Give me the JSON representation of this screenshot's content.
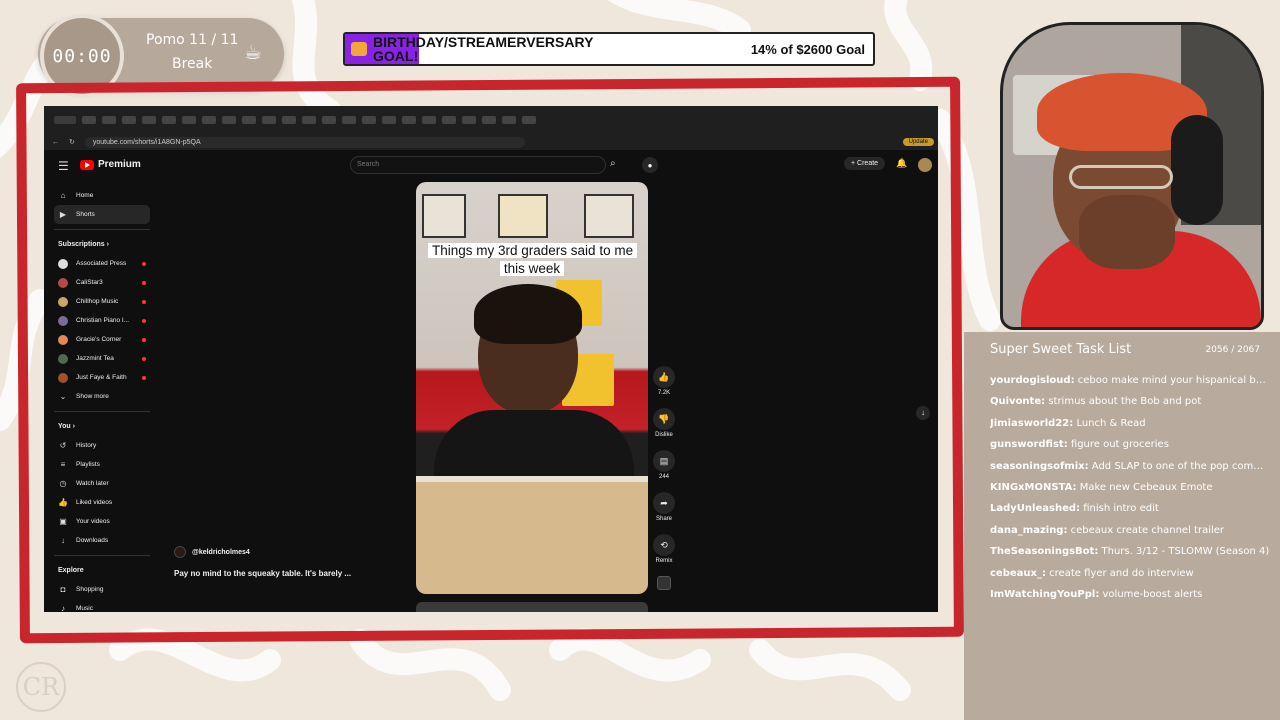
{
  "pomodoro": {
    "time": "00:00",
    "label": "Pomo 11 / 11",
    "state": "Break",
    "icon": "coffee-cup-icon"
  },
  "goal": {
    "title": "BIRTHDAY/STREAMERVERSARY GOAL!",
    "progress_text": "14% of $2600 Goal",
    "progress_fraction": 0.14,
    "accent": "#8a22e6"
  },
  "browser": {
    "url": "youtube.com/shorts/i1A8GN-p5QA",
    "update_label": "Update"
  },
  "youtube": {
    "brand": "Premium",
    "search_placeholder": "Search",
    "create_label": "Create",
    "sidebar": {
      "top_items": [
        {
          "label": "Home",
          "icon": "home-icon"
        },
        {
          "label": "Shorts",
          "icon": "shorts-icon"
        }
      ],
      "subscriptions_heading": "Subscriptions",
      "subscriptions": [
        "Associated Press",
        "CaliStar3",
        "Chillhop Music",
        "Christian Piano I...",
        "Gracie's Corner",
        "Jazzmint Tea",
        "Just Faye & Faith"
      ],
      "show_more": "Show more",
      "you_heading": "You",
      "you_items": [
        {
          "label": "History",
          "icon": "history-icon"
        },
        {
          "label": "Playlists",
          "icon": "playlists-icon"
        },
        {
          "label": "Watch later",
          "icon": "clock-icon"
        },
        {
          "label": "Liked videos",
          "icon": "thumbs-up-icon"
        },
        {
          "label": "Your videos",
          "icon": "video-icon"
        },
        {
          "label": "Downloads",
          "icon": "download-icon"
        }
      ],
      "explore_heading": "Explore",
      "explore_items": [
        {
          "label": "Shopping",
          "icon": "bag-icon"
        },
        {
          "label": "Music",
          "icon": "music-icon"
        }
      ]
    },
    "short": {
      "caption": "Things my 3rd graders said to me this week",
      "handle": "@keldricholmes4",
      "description": "Pay no mind to the squeaky table. It's barely ...",
      "actions": [
        {
          "label": "7.2K",
          "icon": "like-icon"
        },
        {
          "label": "Dislike",
          "icon": "dislike-icon"
        },
        {
          "label": "244",
          "icon": "comment-icon"
        },
        {
          "label": "Share",
          "icon": "share-icon"
        },
        {
          "label": "Remix",
          "icon": "remix-icon"
        }
      ]
    }
  },
  "tasks": {
    "title": "Super Sweet Task List",
    "count": "2056 / 2067",
    "items": [
      {
        "user": "yourdogisloud:",
        "text": "ceboo make mind your hispanical busin..."
      },
      {
        "user": "Quivonte:",
        "text": "strimus about the Bob and pot"
      },
      {
        "user": "Jimiasworld22:",
        "text": "Lunch & Read"
      },
      {
        "user": "gunswordfist:",
        "text": "figure out groceries"
      },
      {
        "user": "seasoningsofmix:",
        "text": "Add SLAP to one of the pop commands."
      },
      {
        "user": "KINGxMONSTA:",
        "text": "Make new Cebeaux Emote"
      },
      {
        "user": "LadyUnleashed:",
        "text": "finish intro edit"
      },
      {
        "user": "dana_mazing:",
        "text": "cebeaux create channel trailer"
      },
      {
        "user": "TheSeasoningsBot:",
        "text": "Thurs. 3/12 - TSLOMW (Season 4)"
      },
      {
        "user": "cebeaux_:",
        "text": "create flyer and do interview"
      },
      {
        "user": "ImWatchingYouPpl:",
        "text": "volume-boost alerts"
      }
    ]
  },
  "watermark": "CR"
}
